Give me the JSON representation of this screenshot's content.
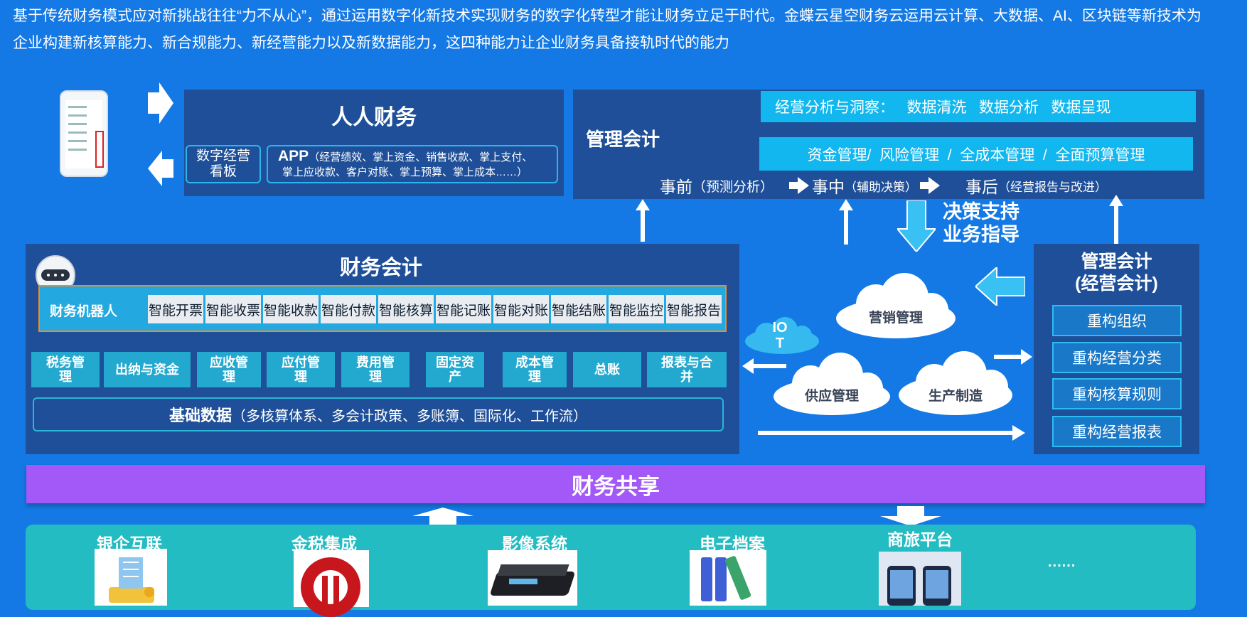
{
  "intro": {
    "line1": "基于传统财务模式应对新挑战往往“力不从心”，通过运用数字化新技术实现财务的数字化转型才能让财务立足于时代。金蝶云星空财务云运用云计算、大数据、AI、区块链等新技术为",
    "line2": "企业构建新核算能力、新合规能力、新经营能力以及新数据能力，这四种能力让企业财务具备接轨时代的能力"
  },
  "renren": {
    "title": "人人财务",
    "dashboard": "数字经营看板",
    "app_label": "APP",
    "app_detail1": "（经营绩效、掌上资金、销售收款、掌上支付、",
    "app_detail2": "掌上应收款、客户对账、掌上预算、掌上成本……）"
  },
  "mgmt_acct": {
    "title": "管理会计",
    "insight": "经营分析与洞察：   数据清洗   数据分析   数据呈现",
    "mgmt_bar": "资金管理/  风险管理  /  全成本管理  /  全面预算管理",
    "before": "事前",
    "before_sub": "（预测分析）",
    "during": "事中",
    "during_sub": "（辅助决策）",
    "after": "事后",
    "after_sub": "（经营报告与改进）"
  },
  "decision": {
    "line1": "决策支持",
    "line2": "业务指导"
  },
  "fin_acct": {
    "title": "财务会计",
    "robot": "财务机器人",
    "smart_items": [
      "智能开票",
      "智能收票",
      "智能收款",
      "智能付款",
      "智能核算",
      "智能记账",
      "智能对账",
      "智能结账",
      "智能监控",
      "智能报告"
    ],
    "modules": [
      "税务管理",
      "出纳与资金",
      "应收管理",
      "应付管理",
      "费用管理",
      "固定资产",
      "成本管理",
      "总账",
      "报表与合并"
    ],
    "base_data": "基础数据",
    "base_detail": "（多核算体系、多会计政策、多账簿、国际化、工作流）"
  },
  "clouds": {
    "iot": "IOT",
    "marketing": "营销管理",
    "supply": "供应管理",
    "production": "生产制造"
  },
  "mgmt_ops": {
    "title1": "管理会计",
    "title2": "(经营会计)",
    "items": [
      "重构组织",
      "重构经营分类",
      "重构核算规则",
      "重构经营报表"
    ]
  },
  "shared": {
    "title": "财务共享"
  },
  "systems": {
    "items": [
      "银企互联",
      "金税集成",
      "影像系统",
      "电子档案",
      "商旅平台"
    ],
    "more": "......"
  },
  "colors": {
    "background": "#1479e4",
    "panel": "#1e4f98",
    "cyan": "#12b7ef",
    "purple": "#a259f7",
    "teal": "#22bcc2",
    "module": "#23a8cf"
  }
}
